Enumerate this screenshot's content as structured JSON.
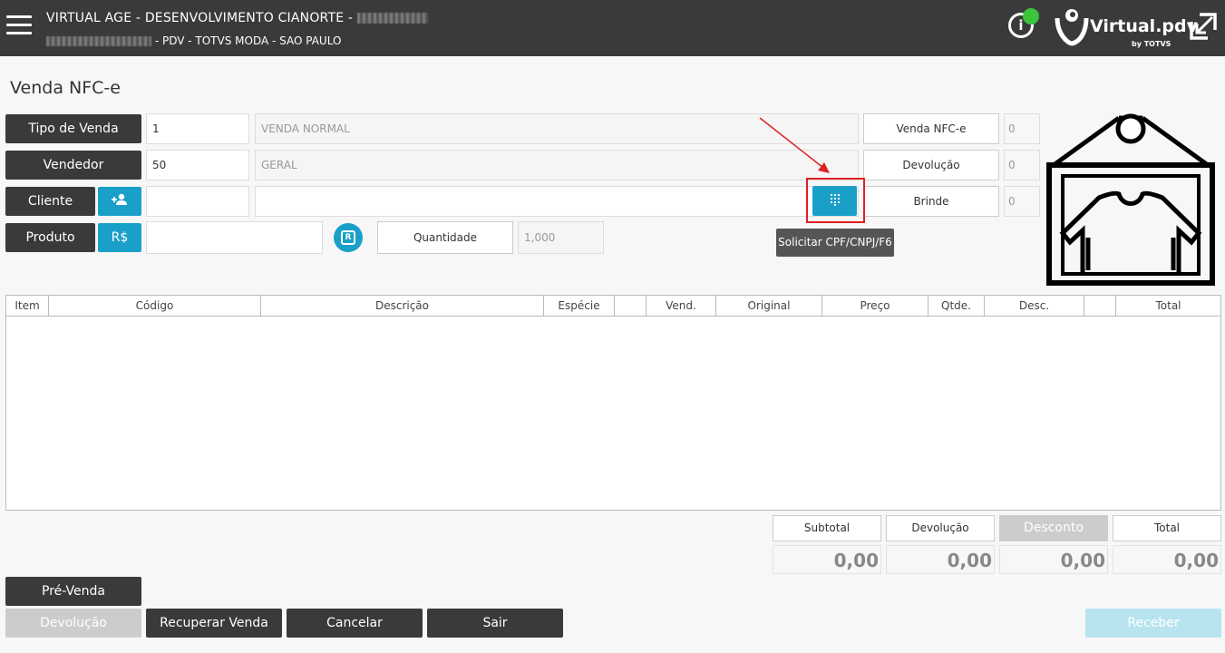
{
  "header": {
    "title_line1": "VIRTUAL AGE - DESENVOLVIMENTO CIANORTE -",
    "title_line2": "- PDV - TOTVS MODA - SAO PAULO",
    "brand_name": "Virtual.pdv",
    "brand_sub": "by TOTVS",
    "status_color": "#3cc43c"
  },
  "page": {
    "title": "Venda NFC-e"
  },
  "form": {
    "tipo_venda_label": "Tipo de Venda",
    "tipo_venda_code": "1",
    "tipo_venda_desc": "VENDA NORMAL",
    "vendedor_label": "Vendedor",
    "vendedor_code": "50",
    "vendedor_desc": "GERAL",
    "cliente_label": "Cliente",
    "cliente_code": "",
    "cliente_desc": "",
    "produto_label": "Produto",
    "produto_price_label": "R$",
    "produto_code": "",
    "quantidade_label": "Quantidade",
    "quantidade_value": "1,000",
    "r_label": "R"
  },
  "counters": {
    "venda_nfce_label": "Venda NFC-e",
    "venda_nfce_value": "0",
    "devolucao_label": "Devolução",
    "devolucao_value": "0",
    "brinde_label": "Brinde",
    "brinde_value": "0"
  },
  "tooltip": {
    "text": "Solicitar CPF/CNPJ/F6"
  },
  "table": {
    "columns": [
      "Item",
      "Código",
      "Descrição",
      "Espécie",
      "",
      "Vend.",
      "Original",
      "Preço",
      "Qtde.",
      "Desc.",
      "",
      "Total"
    ],
    "rows": []
  },
  "totals": {
    "subtotal_label": "Subtotal",
    "subtotal_value": "0,00",
    "devolucao_label": "Devolução",
    "devolucao_value": "0,00",
    "desconto_label": "Desconto",
    "desconto_value": "0,00",
    "total_label": "Total",
    "total_value": "0,00"
  },
  "actions": {
    "pre_venda": "Pré-Venda",
    "devolucao": "Devolução",
    "recuperar_venda": "Recuperar Venda",
    "cancelar": "Cancelar",
    "sair": "Sair",
    "receber": "Receber"
  },
  "icons": {
    "menu": "hamburger-icon",
    "info": "info-icon",
    "expand": "expand-icon",
    "add_user": "add-person-icon",
    "keypad": "dialpad-icon",
    "product_image": "clothing-tag-icon"
  }
}
